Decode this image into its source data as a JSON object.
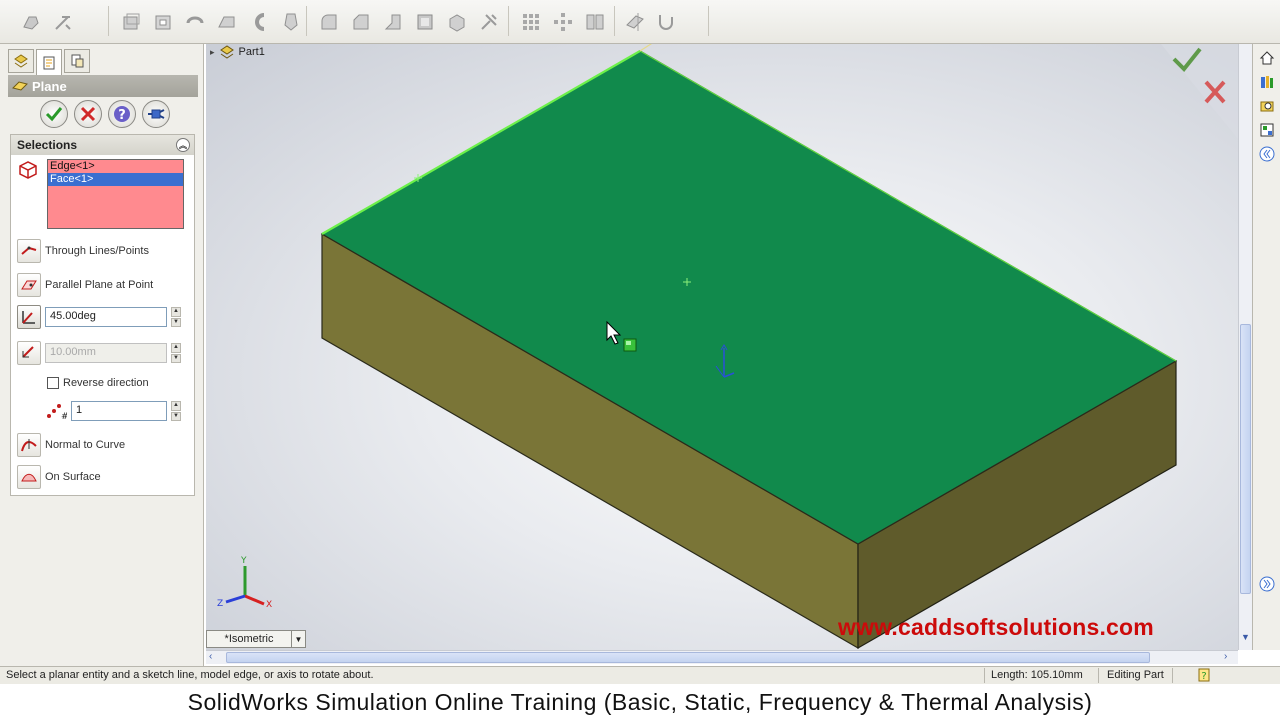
{
  "tree": {
    "root_label": "Part1"
  },
  "property_manager": {
    "title": "Plane",
    "selections_header": "Selections",
    "selected_items": [
      "Edge<1>",
      "Face<1>"
    ],
    "through_lines_label": "Through Lines/Points",
    "parallel_plane_label": "Parallel Plane at Point",
    "angle_value": "45.00deg",
    "distance_value": "10.00mm",
    "reverse_direction_label": "Reverse direction",
    "reverse_direction_checked": false,
    "instances_value": "1",
    "normal_to_curve_label": "Normal to Curve",
    "on_surface_label": "On Surface"
  },
  "viewport": {
    "view_orientation": "*Isometric",
    "watermark": "www.caddsoftsolutions.com",
    "face_color": "#118a4c",
    "side_color": "#7a7537"
  },
  "statusbar": {
    "hint": "Select a planar entity and a sketch line, model edge, or axis to rotate about.",
    "length": "Length: 105.10mm",
    "mode": "Editing Part"
  },
  "caption": "SolidWorks Simulation Online Training (Basic, Static, Frequency & Thermal Analysis)"
}
